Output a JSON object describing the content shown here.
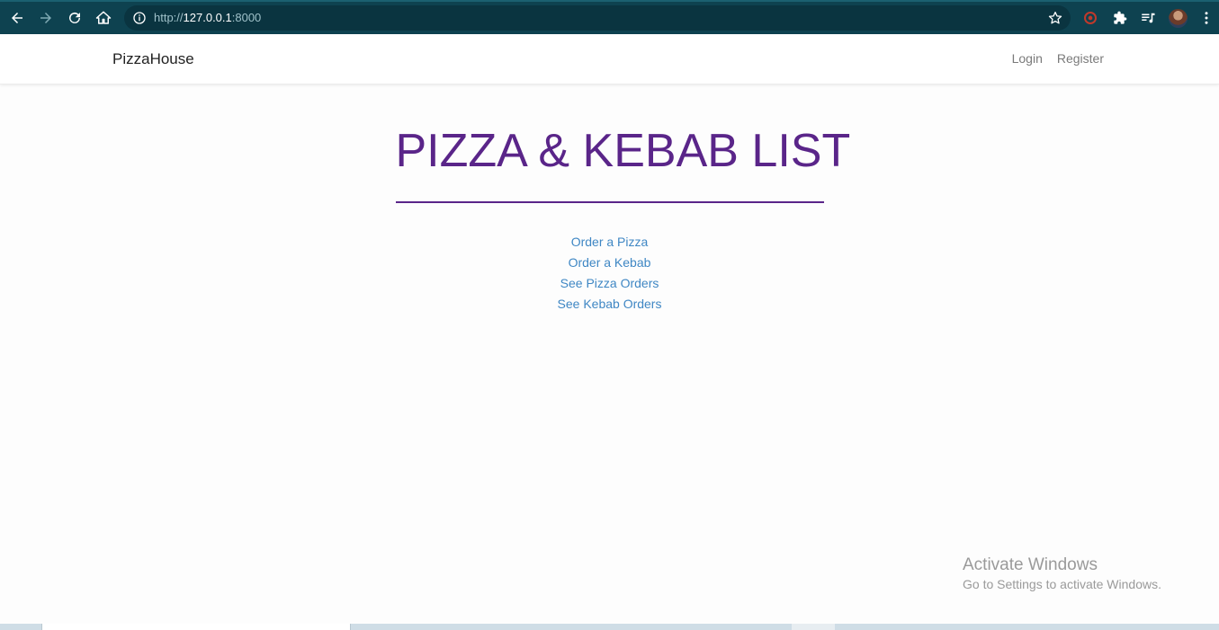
{
  "browser": {
    "url_scheme": "http://",
    "url_host": "127.0.0.1",
    "url_port": ":8000"
  },
  "icons": {
    "back": "back-arrow-icon",
    "forward": "forward-arrow-icon",
    "reload": "reload-icon",
    "home": "home-icon",
    "site_info": "info-icon",
    "bookmark": "star-icon",
    "extension_red": "extension-icon",
    "extensions": "puzzle-icon",
    "media": "media-queue-icon",
    "profile": "avatar",
    "menu": "kebab-menu-icon"
  },
  "navbar": {
    "brand": "PizzaHouse",
    "links": [
      "Login",
      "Register"
    ]
  },
  "main": {
    "title": "PIZZA & KEBAB LIST",
    "links": [
      "Order a Pizza",
      "Order a Kebab",
      "See Pizza Orders",
      "See Kebab Orders"
    ]
  },
  "watermark": {
    "title": "Activate Windows",
    "subtitle": "Go to Settings to activate Windows."
  },
  "colors": {
    "chrome": "#0e4250",
    "title": "#5a2589",
    "link": "#3f87c4"
  }
}
